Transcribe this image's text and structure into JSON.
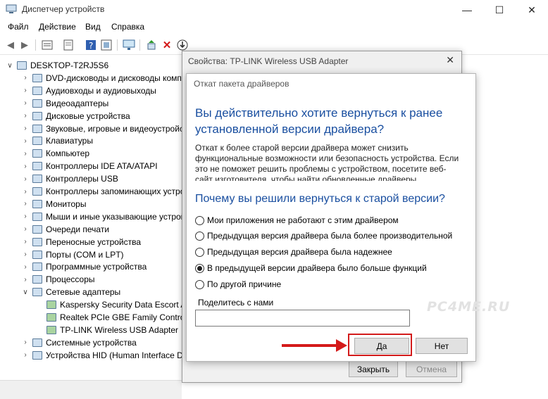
{
  "window": {
    "title": "Диспетчер устройств"
  },
  "menu": [
    "Файл",
    "Действие",
    "Вид",
    "Справка"
  ],
  "toolbar_icons": [
    "back-icon",
    "forward-icon",
    "properties-icon",
    "refresh-icon",
    "help-icon",
    "show-hidden-icon",
    "monitor-icon",
    "add-driver-icon",
    "delete-icon",
    "download-icon"
  ],
  "tree": {
    "root": "DESKTOP-T2RJ5S6",
    "items": [
      "DVD-дисководы и дисководы компакт-дисков",
      "Аудиовходы и аудиовыходы",
      "Видеоадаптеры",
      "Дисковые устройства",
      "Звуковые, игровые и видеоустройства",
      "Клавиатуры",
      "Компьютер",
      "Контроллеры IDE ATA/ATAPI",
      "Контроллеры USB",
      "Контроллеры запоминающих устройств",
      "Мониторы",
      "Мыши и иные указывающие устройства",
      "Очереди печати",
      "Переносные устройства",
      "Порты (COM и LPT)",
      "Программные устройства",
      "Процессоры",
      "Сетевые адаптеры"
    ],
    "network_children": [
      "Kaspersky Security Data Escort Adapter",
      "Realtek PCIe GBE Family Controller",
      "TP-LINK Wireless USB Adapter"
    ],
    "items_after": [
      "Системные устройства",
      "Устройства HID (Human Interface Devices)"
    ]
  },
  "properties_dialog": {
    "title": "Свойства: TP-LINK Wireless USB Adapter",
    "close_button": "Закрыть",
    "cancel_button": "Отмена"
  },
  "rollback_dialog": {
    "title": "Откат пакета драйверов",
    "question": "Вы действительно хотите вернуться к ранее установленной версии драйвера?",
    "description": "Откат к более старой версии драйвера может снизить функциональные возможности или безопасность устройства. Если это не поможет решить проблемы с устройством, посетите веб-сайт изготовителя, чтобы найти обновленные драйверы.",
    "why_question": "Почему вы решили вернуться к старой версии?",
    "options": [
      "Мои приложения не работают с этим драйвером",
      "Предыдущая версия драйвера была более производительной",
      "Предыдущая версия драйвера была надежнее",
      "В предыдущей версии драйвера было больше функций",
      "По другой причине"
    ],
    "selected_option": "В предыдущей версии драйвера было больше функций",
    "share_label": "Поделитесь с нами",
    "share_value": "",
    "yes_button": "Да",
    "no_button": "Нет"
  },
  "watermark": "PC4ME.RU",
  "colors": {
    "accent_text": "#1a4fa0",
    "highlight": "#d31b1b"
  }
}
